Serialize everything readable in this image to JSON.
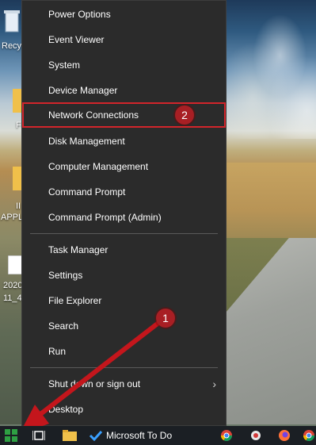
{
  "desktop": {
    "icons": [
      {
        "label": "Recy"
      },
      {
        "label": "F"
      },
      {
        "label": "II"
      },
      {
        "label": "APPL"
      },
      {
        "label": "2020"
      },
      {
        "label": "11_4"
      }
    ]
  },
  "menu": {
    "items": [
      {
        "label": "Power Options"
      },
      {
        "label": "Event Viewer"
      },
      {
        "label": "System"
      },
      {
        "label": "Device Manager"
      },
      {
        "label": "Network Connections"
      },
      {
        "label": "Disk Management"
      },
      {
        "label": "Computer Management"
      },
      {
        "label": "Command Prompt"
      },
      {
        "label": "Command Prompt (Admin)"
      },
      {
        "label": "Task Manager"
      },
      {
        "label": "Settings"
      },
      {
        "label": "File Explorer"
      },
      {
        "label": "Search"
      },
      {
        "label": "Run"
      },
      {
        "label": "Shut down or sign out"
      },
      {
        "label": "Desktop"
      }
    ],
    "highlight_color": "#d2252b"
  },
  "annotations": {
    "step1": "1",
    "step2": "2",
    "arrow_color": "#c4161c"
  },
  "taskbar": {
    "start_icon": "windows-logo-icon",
    "task_view_icon": "task-view-icon",
    "file_explorer_icon": "folder-icon",
    "todo_label": "Microsoft To Do",
    "todo_icon": "checkmark-icon",
    "tray_icons": [
      "chrome-icon",
      "app-icon",
      "firefox-icon",
      "chrome-icon"
    ],
    "accent": "#00a2ed"
  }
}
